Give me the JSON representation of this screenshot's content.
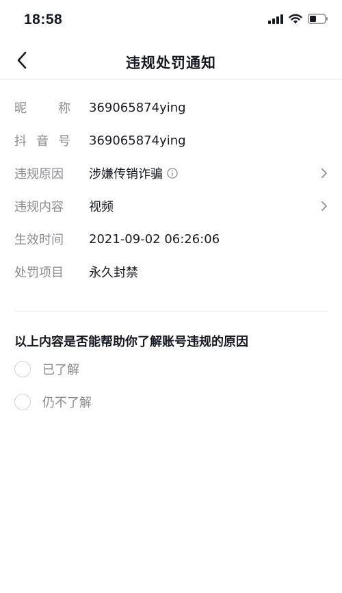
{
  "status_bar": {
    "time": "18:58",
    "icons": [
      "signal-icon",
      "wifi-icon",
      "battery-icon"
    ]
  },
  "header": {
    "title": "违规处罚通知",
    "back_icon": "chevron-left-icon"
  },
  "details": [
    {
      "label_chars": [
        "昵",
        "称"
      ],
      "value": "369065874ying",
      "has_arrow": false,
      "has_info": false
    },
    {
      "label_chars": [
        "抖",
        "音",
        "号"
      ],
      "value": "369065874ying",
      "has_arrow": false,
      "has_info": false
    },
    {
      "label_chars": [
        "违规原因"
      ],
      "value": "涉嫌传销诈骗",
      "has_arrow": true,
      "has_info": true
    },
    {
      "label_chars": [
        "违规内容"
      ],
      "value": "视频",
      "has_arrow": true,
      "has_info": false
    },
    {
      "label_chars": [
        "生效时间"
      ],
      "value": "2021-09-02 06:26:06",
      "has_arrow": false,
      "has_info": false
    },
    {
      "label_chars": [
        "处罚项目"
      ],
      "value": "永久封禁",
      "has_arrow": false,
      "has_info": false
    }
  ],
  "feedback": {
    "question": "以上内容是否能帮助你了解账号违规的原因",
    "options": [
      "已了解",
      "仍不了解"
    ]
  },
  "colors": {
    "text_primary": "#161823",
    "text_secondary": "#8a8b91",
    "divider": "#ececec",
    "radio_border": "#cfd0d4"
  }
}
